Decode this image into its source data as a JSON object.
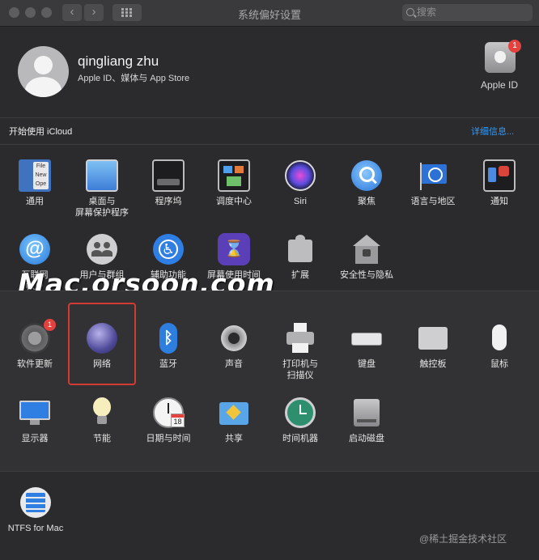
{
  "window": {
    "title": "系统偏好设置",
    "search_placeholder": "搜索"
  },
  "account": {
    "name": "qingliang zhu",
    "subtitle": "Apple ID、媒体与 App Store",
    "apple_id_label": "Apple ID",
    "apple_id_badge": "1"
  },
  "icloud": {
    "label": "开始使用 iCloud",
    "detail_link": "详细信息..."
  },
  "row1": [
    "通用",
    "桌面与\n屏幕保护程序",
    "程序坞",
    "调度中心",
    "Siri",
    "聚焦",
    "语言与地区",
    "通知"
  ],
  "row2": [
    "互联网\n帐户",
    "用户与群组",
    "辅助功能",
    "屏幕使用时间",
    "扩展",
    "安全性与隐私"
  ],
  "row3": [
    "软件更新",
    "网络",
    "蓝牙",
    "声音",
    "打印机与\n扫描仪",
    "键盘",
    "触控板",
    "鼠标"
  ],
  "row4": [
    "显示器",
    "节能",
    "日期与时间",
    "共享",
    "时间机器",
    "启动磁盘"
  ],
  "row5": [
    "NTFS for Mac"
  ],
  "badges": {
    "software_update": "1"
  },
  "calendar_day": "18",
  "watermark": "Mac.orsoon.com",
  "credit": "@稀土掘金技术社区",
  "colors": {
    "background": "#2b2b2d",
    "link": "#3a98ef",
    "badge": "#e3423f",
    "highlight": "#d23a33"
  }
}
